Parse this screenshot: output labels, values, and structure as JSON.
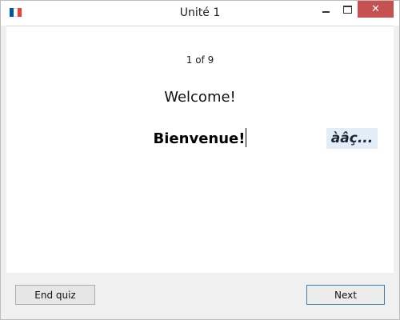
{
  "window": {
    "title": "Unité 1",
    "flag_colors": [
      "#0055a4",
      "#ffffff",
      "#ef4135"
    ],
    "icon": "flag-france-icon",
    "controls": {
      "minimize": "minimize-icon",
      "maximize": "maximize-icon",
      "close_glyph": "✕"
    }
  },
  "quiz": {
    "progress": "1 of 9",
    "prompt": "Welcome!",
    "answer": "Bienvenue!",
    "accent_button": "àâç..."
  },
  "footer": {
    "end_label": "End quiz",
    "next_label": "Next"
  }
}
